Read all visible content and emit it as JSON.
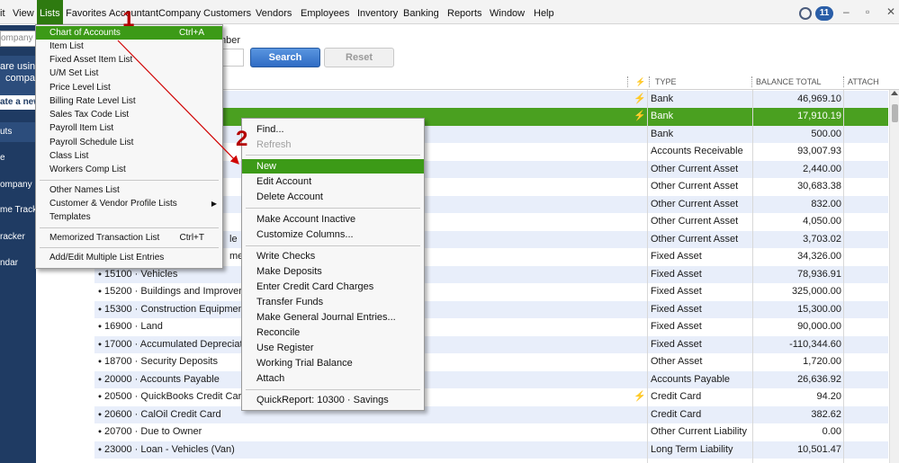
{
  "menubar": {
    "items": [
      "it",
      "View",
      "Lists",
      "Favorites",
      "Accountant",
      "Company",
      "Customers",
      "Vendors",
      "Employees",
      "Inventory",
      "Banking",
      "Reports",
      "Window",
      "Help"
    ],
    "reminder_count": "11"
  },
  "leftbar": {
    "search_placeholder": "ompany or",
    "promo_line1": "are usin",
    "promo_line2": "compa",
    "create_new": "ate a new",
    "section": "uts",
    "items": [
      "e",
      "ompany",
      "me Tracke",
      "racker",
      "ndar"
    ]
  },
  "filter": {
    "label": "mber",
    "search_button": "Search",
    "reset_button": "Reset"
  },
  "table": {
    "headers": {
      "bolt": "⚡",
      "type": "TYPE",
      "balance": "BALANCE TOTAL",
      "attach": "ATTACH"
    },
    "rows": [
      {
        "name": "",
        "bolt": "⚡",
        "type": "Bank",
        "balance": "46,969.10"
      },
      {
        "name": "",
        "bolt": "⚡",
        "type": "Bank",
        "balance": "17,910.19"
      },
      {
        "name": "",
        "bolt": "",
        "type": "Bank",
        "balance": "500.00"
      },
      {
        "name": "",
        "bolt": "",
        "type": "Accounts Receivable",
        "balance": "93,007.93"
      },
      {
        "name": "",
        "bolt": "",
        "type": "Other Current Asset",
        "balance": "2,440.00"
      },
      {
        "name": "",
        "bolt": "",
        "type": "Other Current Asset",
        "balance": "30,683.38"
      },
      {
        "name": "",
        "bolt": "",
        "type": "Other Current Asset",
        "balance": "832.00"
      },
      {
        "name": "",
        "bolt": "",
        "type": "Other Current Asset",
        "balance": "4,050.00"
      },
      {
        "name": "",
        "bolt": "",
        "type": "Other Current Asset",
        "balance": "3,703.02"
      },
      {
        "name": "",
        "bolt": "",
        "type": "Fixed Asset",
        "balance": "34,326.00"
      },
      {
        "name": "⬩ 15100 · Vehicles",
        "bolt": "",
        "type": "Fixed Asset",
        "balance": "78,936.91"
      },
      {
        "name": "⬩ 15200 · Buildings and Improveme",
        "bolt": "",
        "type": "Fixed Asset",
        "balance": "325,000.00"
      },
      {
        "name": "⬩ 15300 · Construction Equipment",
        "bolt": "",
        "type": "Fixed Asset",
        "balance": "15,300.00"
      },
      {
        "name": "⬩ 16900 · Land",
        "bolt": "",
        "type": "Fixed Asset",
        "balance": "90,000.00"
      },
      {
        "name": "⬩ 17000 · Accumulated Depreciatio",
        "bolt": "",
        "type": "Fixed Asset",
        "balance": "-110,344.60"
      },
      {
        "name": "⬩ 18700 · Security Deposits",
        "bolt": "",
        "type": "Other Asset",
        "balance": "1,720.00"
      },
      {
        "name": "⬩ 20000 · Accounts Payable",
        "bolt": "",
        "type": "Accounts Payable",
        "balance": "26,636.92"
      },
      {
        "name": "⬩ 20500 · QuickBooks Credit Card",
        "bolt": "⚡",
        "type": "Credit Card",
        "balance": "94.20"
      },
      {
        "name": "⬩ 20600 · CalOil Credit Card",
        "bolt": "",
        "type": "Credit Card",
        "balance": "382.62"
      },
      {
        "name": "⬩ 20700 · Due to Owner",
        "bolt": "",
        "type": "Other Current Liability",
        "balance": "0.00"
      },
      {
        "name": "⬩ 23000 · Loan - Vehicles (Van)",
        "bolt": "",
        "type": "Long Term Liability",
        "balance": "10,501.47"
      }
    ],
    "partial_name_8": "le",
    "partial_name_9": "ment"
  },
  "lists_menu": {
    "items": [
      {
        "label": "Chart of Accounts",
        "shortcut": "Ctrl+A"
      },
      {
        "label": "Item List",
        "shortcut": ""
      },
      {
        "label": "Fixed Asset Item List",
        "shortcut": ""
      },
      {
        "label": "U/M Set List",
        "shortcut": ""
      },
      {
        "label": "Price Level List",
        "shortcut": ""
      },
      {
        "label": "Billing Rate Level List",
        "shortcut": ""
      },
      {
        "label": "Sales Tax Code List",
        "shortcut": ""
      },
      {
        "label": "Payroll Item List",
        "shortcut": ""
      },
      {
        "label": "Payroll Schedule List",
        "shortcut": ""
      },
      {
        "label": "Class List",
        "shortcut": ""
      },
      {
        "label": "Workers Comp List",
        "shortcut": ""
      },
      {
        "label": "Other Names List",
        "shortcut": ""
      },
      {
        "label": "Customer & Vendor Profile Lists",
        "shortcut": ""
      },
      {
        "label": "Templates",
        "shortcut": ""
      },
      {
        "label": "Memorized Transaction List",
        "shortcut": "Ctrl+T"
      },
      {
        "label": "Add/Edit Multiple List Entries",
        "shortcut": ""
      }
    ]
  },
  "context_menu": {
    "items": [
      "Find...",
      "Refresh",
      "New",
      "Edit Account",
      "Delete Account",
      "Make Account Inactive",
      "Customize Columns...",
      "Write Checks",
      "Make Deposits",
      "Enter Credit Card Charges",
      "Transfer Funds",
      "Make General Journal Entries...",
      "Reconcile",
      "Use Register",
      "Working Trial Balance",
      "Attach",
      "QuickReport: 10300 · Savings"
    ]
  },
  "annotations": {
    "step1": "1",
    "step2": "2"
  },
  "colors": {
    "highlight": "#3c9a17",
    "selected_row": "#4aa020",
    "annotation": "#b40000",
    "search_button": "#2e6bc4"
  }
}
